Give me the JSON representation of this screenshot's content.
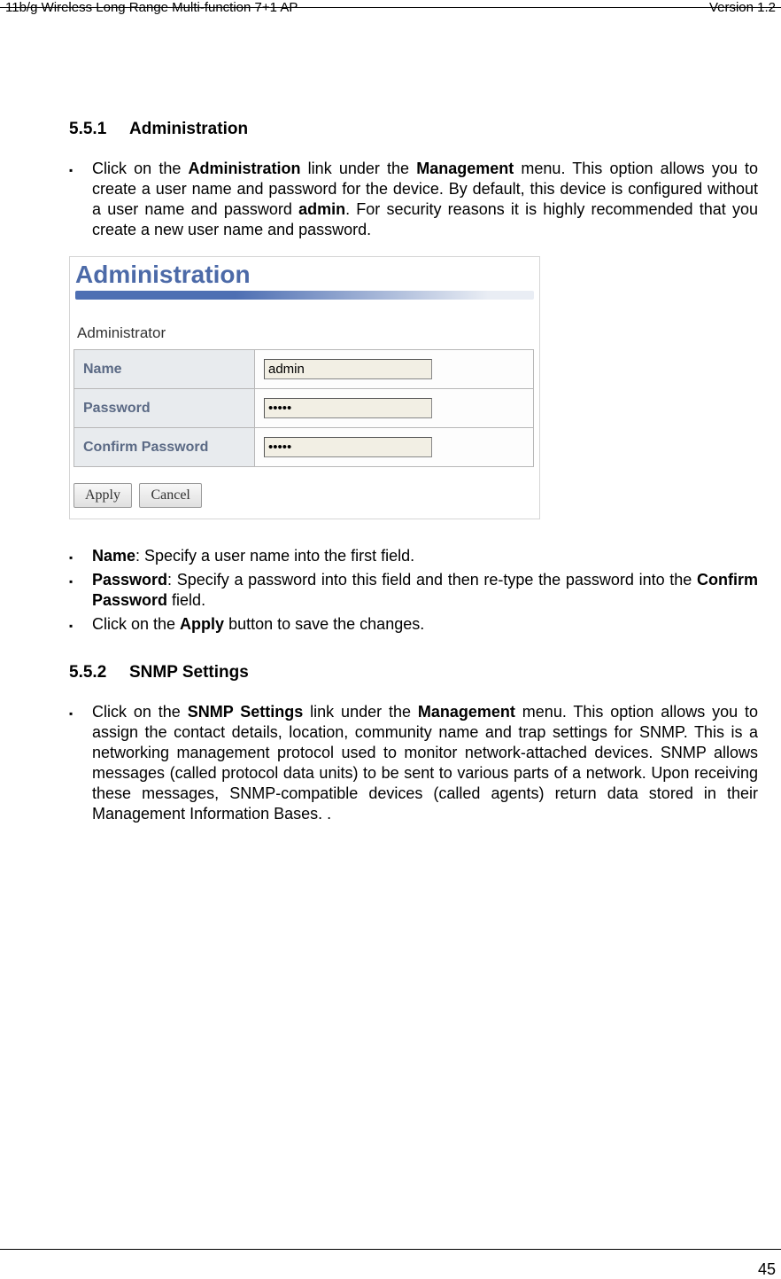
{
  "header": {
    "left": "11b/g Wireless Long Range Multi-function 7+1 AP",
    "right": "Version 1.2"
  },
  "section1": {
    "num": "5.5.1",
    "title": "Administration",
    "intro_a": "Click on the ",
    "intro_b": "Administration",
    "intro_c": " link under the ",
    "intro_d": "Management",
    "intro_e": " menu. This option allows you to create a user name and password for the device. By default, this device is configured without a user name and password ",
    "intro_f": "admin",
    "intro_g": ". For security reasons it is highly recommended that you create a new user name and password."
  },
  "panel": {
    "title": "Administration",
    "subtitle": "Administrator",
    "row_name": "Name",
    "row_pass": "Password",
    "row_conf": "Confirm Password",
    "val_name": "admin",
    "val_pass": "•••••",
    "val_conf": "•••••",
    "btn_apply": "Apply",
    "btn_cancel": "Cancel"
  },
  "bullets2": {
    "b1_a": "Name",
    "b1_b": ": Specify a user name into the first field.",
    "b2_a": "Password",
    "b2_b": ": Specify a password into this field and then re-type the password into the ",
    "b2_c": "Confirm Password",
    "b2_d": " field.",
    "b3_a": "Click on the ",
    "b3_b": "Apply",
    "b3_c": " button to save the changes."
  },
  "section2": {
    "num": "5.5.2",
    "title": "SNMP Settings",
    "p_a": "Click on the ",
    "p_b": "SNMP Settings",
    "p_c": " link under the ",
    "p_d": "Management",
    "p_e": " menu. This option allows you to assign the contact details, location, community name and trap settings for SNMP. This is a networking management protocol used to monitor network-attached devices. SNMP allows messages (called protocol data units) to be sent to various parts of a network. Upon receiving these messages, SNMP-compatible devices (called agents) return data stored in their Management Information Bases. ."
  },
  "footer": {
    "page": "45"
  }
}
